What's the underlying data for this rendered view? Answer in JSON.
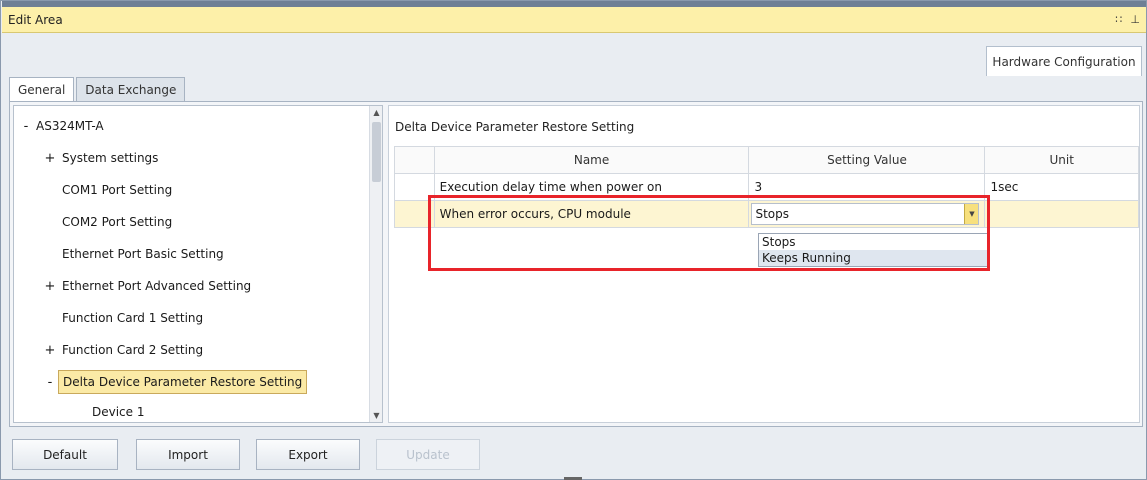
{
  "window": {
    "title": "Edit Area"
  },
  "top_tab": {
    "label": "Hardware Configuration"
  },
  "sub_tabs": [
    {
      "label": "General"
    },
    {
      "label": "Data Exchange"
    }
  ],
  "tree": {
    "items": [
      {
        "sign": "-",
        "label": "AS324MT-A"
      },
      {
        "sign": "+",
        "label": "System settings"
      },
      {
        "sign": "",
        "label": "COM1 Port Setting"
      },
      {
        "sign": "",
        "label": "COM2 Port Setting"
      },
      {
        "sign": "",
        "label": "Ethernet Port Basic Setting"
      },
      {
        "sign": "+",
        "label": "Ethernet Port Advanced Setting"
      },
      {
        "sign": "",
        "label": "Function Card 1 Setting"
      },
      {
        "sign": "+",
        "label": "Function Card 2 Setting"
      },
      {
        "sign": "-",
        "label": "Delta Device Parameter Restore Setting"
      },
      {
        "sign": "",
        "label": "Device 1"
      }
    ]
  },
  "panel": {
    "title": "Delta Device Parameter Restore Setting",
    "columns": {
      "name": "Name",
      "value": "Setting Value",
      "unit": "Unit"
    },
    "rows": [
      {
        "name": "Execution delay time when power on",
        "value": "3",
        "unit": "1sec"
      },
      {
        "name": "When error occurs, CPU module",
        "value": "Stops",
        "unit": ""
      }
    ],
    "dropdown_options": [
      "Stops",
      "Keeps Running"
    ]
  },
  "buttons": {
    "default": "Default",
    "import": "Import",
    "export": "Export",
    "update": "Update"
  },
  "colors": {
    "title_bar": "#fdf0a9",
    "selection": "#fbeaa6",
    "highlight_box": "#e8242a"
  }
}
